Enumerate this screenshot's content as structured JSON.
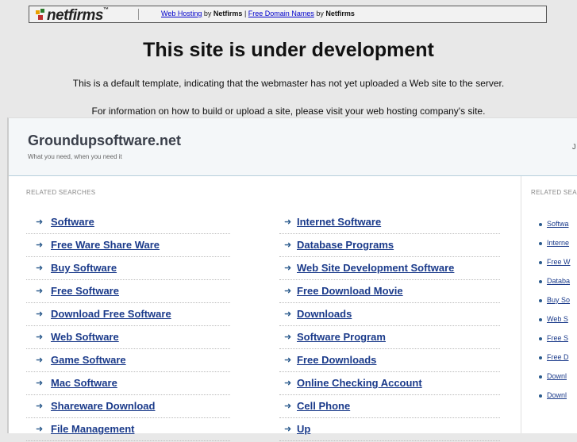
{
  "topbar": {
    "logo_text": "netfirms",
    "link1": "Web Hosting",
    "by1": "by",
    "brand1": "Netfirms",
    "divider": "|",
    "link2": "Free Domain Names",
    "by2": "by",
    "brand2": "Netfirms"
  },
  "heading": "This site is under development",
  "para1": "This is a default template, indicating that the webmaster has not yet uploaded a Web site to the server.",
  "para2": "For information on how to build or upload a site, please visit your web hosting company's site.",
  "site": {
    "name": "Groundupsoftware.net",
    "tagline": "What you need, when you need it",
    "right_fragment": "J"
  },
  "main": {
    "label": "RELATED SEARCHES",
    "left": [
      "Software",
      "Free Ware Share Ware",
      "Buy Software",
      "Free Software",
      "Download Free Software",
      "Web Software",
      "Game Software",
      "Mac Software",
      "Shareware Download",
      "File Management"
    ],
    "right": [
      "Internet Software",
      "Database Programs",
      "Web Site Development Software",
      "Free Download Movie",
      "Downloads",
      "Software Program",
      "Free Downloads",
      "Online Checking Account",
      "Cell Phone",
      "Up"
    ]
  },
  "side": {
    "label": "RELATED SEA",
    "items": [
      "Softwa",
      "Interne",
      "Free W",
      "Databa",
      "Buy So",
      "Web S",
      "Free S",
      "Free D",
      "Downl",
      "Downl"
    ]
  },
  "colors": {
    "link": "#1a3a8a",
    "arrow": "#2a5a8c",
    "header_bg": "#f4f7f9"
  }
}
